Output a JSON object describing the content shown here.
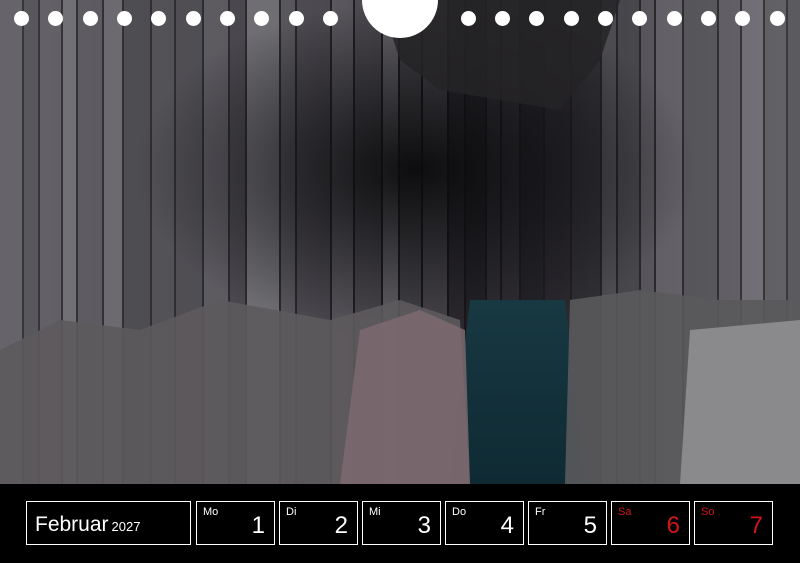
{
  "calendar": {
    "month": "Februar",
    "year": "2027",
    "days": [
      {
        "abbr": "Mo",
        "num": "1",
        "weekend": false
      },
      {
        "abbr": "Di",
        "num": "2",
        "weekend": false
      },
      {
        "abbr": "Mi",
        "num": "3",
        "weekend": false
      },
      {
        "abbr": "Do",
        "num": "4",
        "weekend": false
      },
      {
        "abbr": "Fr",
        "num": "5",
        "weekend": false
      },
      {
        "abbr": "Sa",
        "num": "6",
        "weekend": true
      },
      {
        "abbr": "So",
        "num": "7",
        "weekend": true
      }
    ]
  },
  "colors": {
    "background": "#000000",
    "text": "#ffffff",
    "weekend": "#d0141a",
    "water": "#1f4656"
  }
}
